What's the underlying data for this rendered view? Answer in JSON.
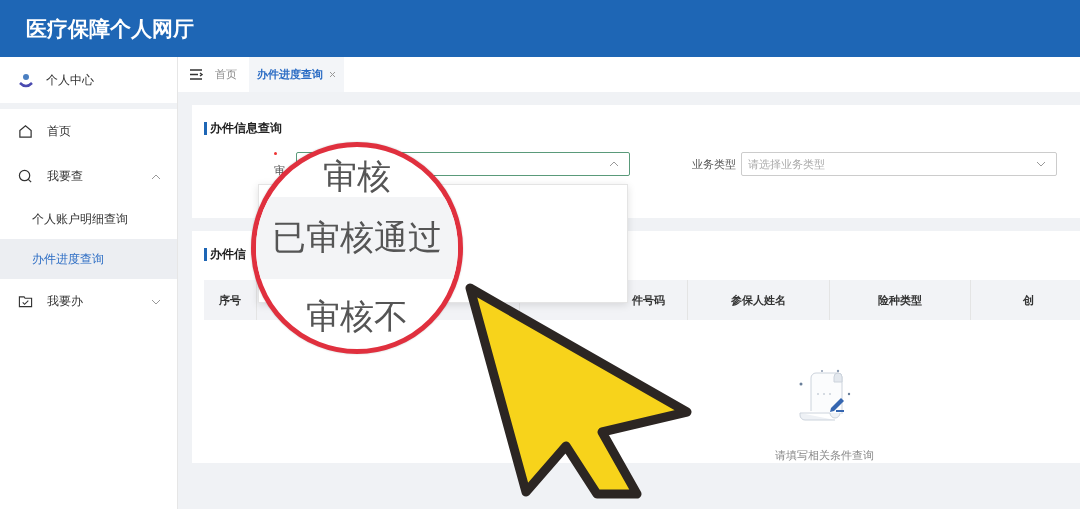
{
  "header": {
    "title": "医疗保障个人网厅"
  },
  "sidebar": {
    "items": [
      {
        "kind": "user",
        "label": "个人中心"
      },
      {
        "kind": "home",
        "label": "首页"
      },
      {
        "kind": "search",
        "label": "我要查",
        "expanded": true,
        "children": [
          {
            "label": "个人账户明细查询",
            "selected": false
          },
          {
            "label": "办件进度查询",
            "selected": true
          }
        ]
      },
      {
        "kind": "folder",
        "label": "我要办",
        "expanded": false
      }
    ]
  },
  "tabs": [
    {
      "label": "首页",
      "selected": false,
      "closable": false
    },
    {
      "label": "办件进度查询",
      "selected": true,
      "closable": true
    }
  ],
  "query_card": {
    "title": "办件信息查询",
    "fields": [
      {
        "label": "审",
        "required": true,
        "expanded": true
      },
      {
        "label": "业务类型",
        "required": false,
        "placeholder": "请选择业务类型",
        "expanded": false
      }
    ]
  },
  "result_card": {
    "title": "办件信",
    "columns": [
      "序号",
      "",
      "件号码",
      "参保人姓名",
      "险种类型",
      "创"
    ],
    "empty_text": "请填写相关条件查询"
  },
  "magnifier": {
    "items": [
      {
        "label": "审核",
        "selected": false
      },
      {
        "label": "已审核通过",
        "selected": true
      },
      {
        "label": "审核不",
        "selected": false
      }
    ]
  }
}
